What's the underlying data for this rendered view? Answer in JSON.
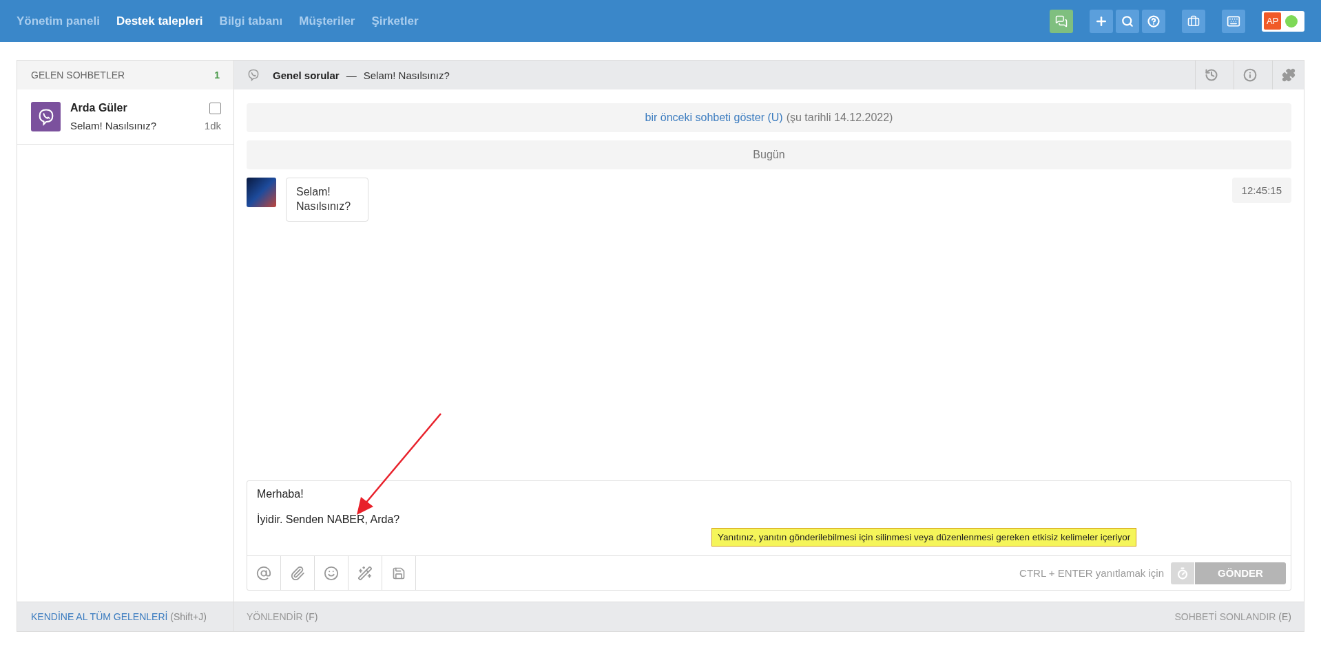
{
  "nav": {
    "items": [
      {
        "label": "Yönetim paneli",
        "selected": false
      },
      {
        "label": "Destek talepleri",
        "selected": true
      },
      {
        "label": "Bilgi tabanı",
        "selected": false
      },
      {
        "label": "Müşteriler",
        "selected": false
      },
      {
        "label": "Şirketler",
        "selected": false
      }
    ],
    "user": {
      "initials": "AP",
      "online": true
    }
  },
  "incoming": {
    "title": "GELEN SOHBETLER",
    "count": "1",
    "chats": [
      {
        "name": "Arda Güler",
        "preview": "Selam! Nasılsınız?",
        "time": "1dk",
        "checked": false
      }
    ]
  },
  "chat": {
    "title": "Genel sorular",
    "separator": "—",
    "subtitle": "Selam! Nasılsınız?",
    "previous": {
      "link": "bir önceki sohbeti göster (U)",
      "note": "(şu tarihli 14.12.2022)"
    },
    "day": "Bugün",
    "messages": [
      {
        "text": "Selam! Nasılsınız?",
        "time": "12:45:15"
      }
    ]
  },
  "composer": {
    "paragraphs": [
      "Merhaba!",
      "İyidir. Senden NABER, Arda?"
    ],
    "warning": "Yanıtınız, yanıtın gönderilebilmesi için silinmesi veya düzenlenmesi gereken etkisiz kelimeler içeriyor",
    "hint": "CTRL + ENTER yanıtlamak için",
    "send": {
      "label": "GÖNDER",
      "disabled": true
    }
  },
  "footer": {
    "take_all": {
      "label": "KENDİNE AL TÜM GELENLERİ",
      "shortcut": "(Shift+J)"
    },
    "forward": {
      "label": "YÖNLENDİR",
      "shortcut": "(F)"
    },
    "end": {
      "label": "SOHBETİ SONLANDIR",
      "shortcut": "(E)"
    }
  }
}
